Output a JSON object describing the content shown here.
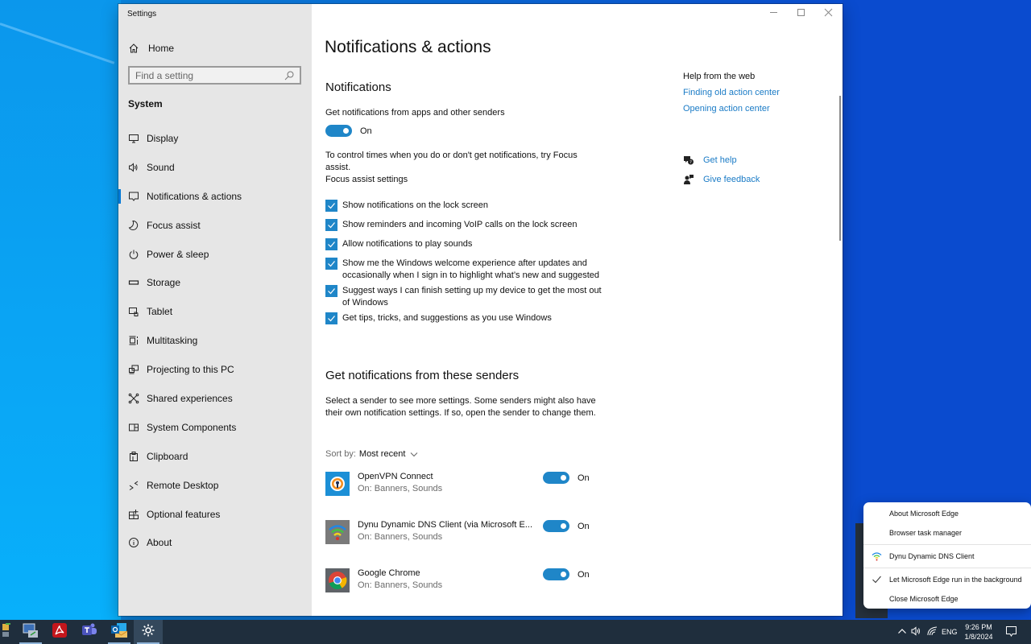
{
  "window": {
    "title": "Settings",
    "controls": [
      "minimize",
      "maximize",
      "close"
    ]
  },
  "sidebar": {
    "home_label": "Home",
    "search": {
      "placeholder": "Find a setting",
      "value": ""
    },
    "section": "System",
    "items": [
      {
        "label": "Display",
        "icon": "display-icon",
        "active": false
      },
      {
        "label": "Sound",
        "icon": "speaker-icon",
        "active": false
      },
      {
        "label": "Notifications & actions",
        "icon": "notification-icon",
        "active": true
      },
      {
        "label": "Focus assist",
        "icon": "moon-icon",
        "active": false
      },
      {
        "label": "Power & sleep",
        "icon": "power-icon",
        "active": false
      },
      {
        "label": "Storage",
        "icon": "storage-icon",
        "active": false
      },
      {
        "label": "Tablet",
        "icon": "tablet-icon",
        "active": false
      },
      {
        "label": "Multitasking",
        "icon": "multitasking-icon",
        "active": false
      },
      {
        "label": "Projecting to this PC",
        "icon": "projecting-icon",
        "active": false
      },
      {
        "label": "Shared experiences",
        "icon": "shared-icon",
        "active": false
      },
      {
        "label": "System Components",
        "icon": "components-icon",
        "active": false
      },
      {
        "label": "Clipboard",
        "icon": "clipboard-icon",
        "active": false
      },
      {
        "label": "Remote Desktop",
        "icon": "remote-desktop-icon",
        "active": false
      },
      {
        "label": "Optional features",
        "icon": "optional-features-icon",
        "active": false
      },
      {
        "label": "About",
        "icon": "info-icon",
        "active": false
      }
    ]
  },
  "main": {
    "title": "Notifications & actions",
    "notifications": {
      "heading": "Notifications",
      "master_label": "Get notifications from apps and other senders",
      "master_state": "On",
      "focus_hint": "To control times when you do or don't get notifications, try Focus assist.",
      "focus_link": "Focus assist settings",
      "checkboxes": [
        {
          "label": "Show notifications on the lock screen",
          "checked": true
        },
        {
          "label": "Show reminders and incoming VoIP calls on the lock screen",
          "checked": true
        },
        {
          "label": "Allow notifications to play sounds",
          "checked": true
        },
        {
          "label": "Show me the Windows welcome experience after updates and occasionally when I sign in to highlight what’s new and suggested",
          "checked": true
        },
        {
          "label": "Suggest ways I can finish setting up my device to get the most out of Windows",
          "checked": true
        },
        {
          "label": "Get tips, tricks, and suggestions as you use Windows",
          "checked": true
        }
      ]
    },
    "senders": {
      "heading": "Get notifications from these senders",
      "description": "Select a sender to see more settings. Some senders might also have their own notification settings. If so, open the sender to change them.",
      "sort_label": "Sort by:",
      "sort_value": "Most recent",
      "list": [
        {
          "name": "OpenVPN Connect",
          "detail": "On: Banners, Sounds",
          "state": "On",
          "icon": "openvpn-icon"
        },
        {
          "name": "Dynu Dynamic DNS Client (via Microsoft E...",
          "detail": "On: Banners, Sounds",
          "state": "On",
          "icon": "dynu-icon"
        },
        {
          "name": "Google Chrome",
          "detail": "On: Banners, Sounds",
          "state": "On",
          "icon": "chrome-icon"
        }
      ]
    },
    "help": {
      "heading": "Help from the web",
      "links": [
        "Finding old action center",
        "Opening action center"
      ],
      "get_help": "Get help",
      "give_feedback": "Give feedback"
    }
  },
  "context_menu": {
    "items": [
      {
        "label": "About Microsoft Edge"
      },
      {
        "label": "Browser task manager"
      },
      {
        "label": "Dynu Dynamic DNS Client",
        "icon": "dynu-icon"
      },
      {
        "label": "Let Microsoft Edge run in the background",
        "checked": true
      },
      {
        "label": "Close Microsoft Edge"
      }
    ]
  },
  "taskbar": {
    "apps": [
      "network-tool-icon",
      "remote-pc-icon",
      "acrobat-icon",
      "teams-icon",
      "outlook-icon",
      "settings-icon"
    ],
    "tray": {
      "language": "ENG",
      "time": "9:26 PM",
      "date": "1/8/2024"
    }
  },
  "colors": {
    "accent": "#1f86c8",
    "link": "#1a7bc6",
    "sidebar_bg": "#e6e6e6",
    "taskbar_bg": "#1f2e3d"
  }
}
